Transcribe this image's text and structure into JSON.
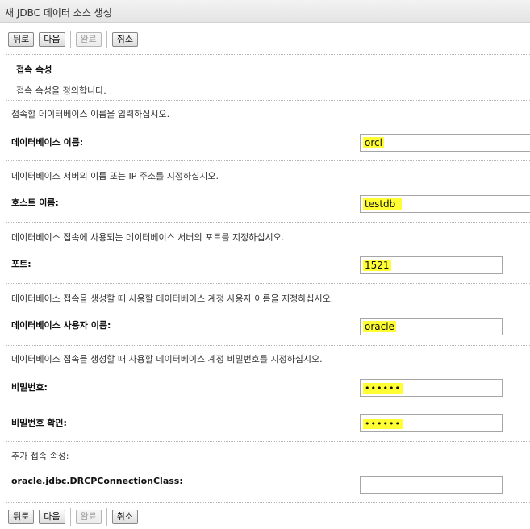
{
  "title": "새 JDBC 데이터 소스 생성",
  "toolbar": {
    "back": "뒤로",
    "next": "다음",
    "finish": "완료",
    "cancel": "취소"
  },
  "section": {
    "title": "접속 속성",
    "subtitle": "접속 속성을 정의합니다."
  },
  "fields": {
    "database_name": {
      "description": "접속할 데이터베이스 이름을 입력하십시오.",
      "label": "데이터베이스 이름:",
      "value": "orcl"
    },
    "host_name": {
      "description": "데이터베이스 서버의 이름 또는 IP 주소를 지정하십시오.",
      "label": "호스트 이름:",
      "value": "testdb"
    },
    "port": {
      "description": "데이터베이스 접속에 사용되는 데이터베이스 서버의 포트를 지정하십시오.",
      "label": "포트:",
      "value": "1521"
    },
    "user_name": {
      "description": "데이터베이스 접속을 생성할 때 사용할 데이터베이스 계정 사용자 이름을 지정하십시오.",
      "label": "데이터베이스 사용자 이름:",
      "value": "oracle"
    },
    "password": {
      "description": "데이터베이스 접속을 생성할 때 사용할 데이터베이스 계정 비밀번호를 지정하십시오.",
      "label": "비밀번호:",
      "value": "••••••"
    },
    "confirm_password": {
      "label": "비밀번호 확인:",
      "value": "••••••"
    },
    "additional": {
      "description": "추가 접속 속성:",
      "label": "oracle.jdbc.DRCPConnectionClass:",
      "value": ""
    }
  },
  "colors": {
    "highlight": "#ffff33",
    "title_bar": "#e9e9e9"
  }
}
